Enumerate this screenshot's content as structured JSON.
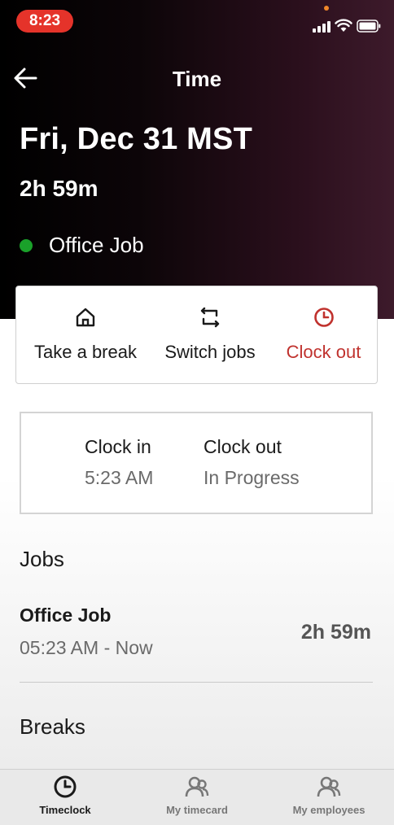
{
  "status_bar": {
    "time": "8:23"
  },
  "header": {
    "title": "Time",
    "date": "Fri, Dec 31 MST",
    "duration": "2h 59m",
    "job_name": "Office Job",
    "job_status_color": "#1aa12a"
  },
  "actions": [
    {
      "label": "Take a break",
      "icon": "home-icon"
    },
    {
      "label": "Switch jobs",
      "icon": "switch-icon"
    },
    {
      "label": "Clock out",
      "icon": "clock-icon",
      "color": "#c0322e"
    }
  ],
  "clock_card": {
    "clock_in_label": "Clock in",
    "clock_in_value": "5:23 AM",
    "clock_out_label": "Clock out",
    "clock_out_value": "In Progress"
  },
  "jobs": {
    "title": "Jobs",
    "items": [
      {
        "name": "Office Job",
        "range": "05:23 AM - Now",
        "duration": "2h 59m"
      }
    ]
  },
  "breaks": {
    "title": "Breaks"
  },
  "tabs": [
    {
      "label": "Timeclock",
      "icon": "clock-icon",
      "active": true
    },
    {
      "label": "My timecard",
      "icon": "person-icon",
      "active": false
    },
    {
      "label": "My employees",
      "icon": "people-icon",
      "active": false
    }
  ]
}
